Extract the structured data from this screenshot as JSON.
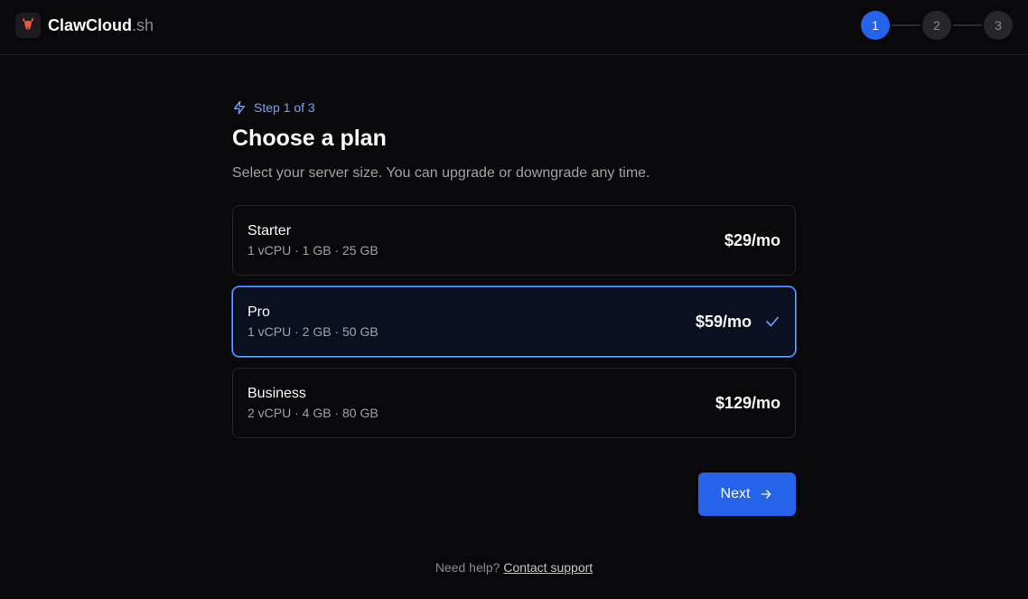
{
  "header": {
    "brand_name": "ClawCloud",
    "brand_tld": ".sh",
    "steps": [
      "1",
      "2",
      "3"
    ],
    "active_step": 1
  },
  "main": {
    "step_label": "Step 1 of 3",
    "title": "Choose a plan",
    "subtitle": "Select your server size. You can upgrade or downgrade any time."
  },
  "plans": [
    {
      "name": "Starter",
      "specs": "1 vCPU · 1 GB · 25 GB",
      "price": "$29/mo",
      "selected": false
    },
    {
      "name": "Pro",
      "specs": "1 vCPU · 2 GB · 50 GB",
      "price": "$59/mo",
      "selected": true
    },
    {
      "name": "Business",
      "specs": "2 vCPU · 4 GB · 80 GB",
      "price": "$129/mo",
      "selected": false
    }
  ],
  "actions": {
    "next_label": "Next"
  },
  "footer": {
    "help_text": "Need help?",
    "help_link": "Contact support"
  },
  "colors": {
    "accent": "#2563eb",
    "background": "#09090b",
    "brand_logo": "#f05a3a"
  },
  "icons": {
    "logo": "claw-logo-icon",
    "step": "lightning-icon",
    "check": "check-icon",
    "next": "arrow-right-icon"
  }
}
